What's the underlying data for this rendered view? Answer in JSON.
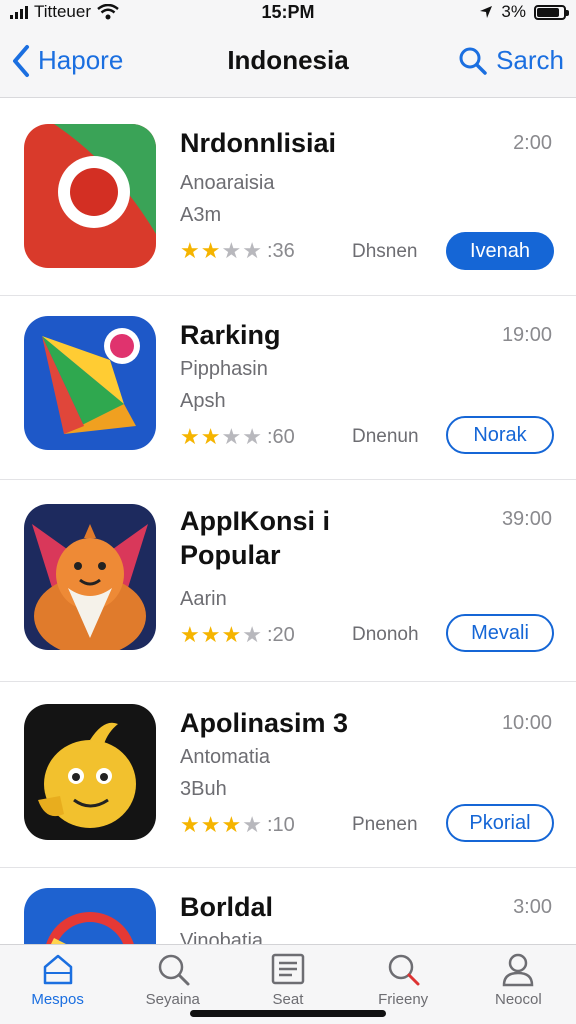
{
  "status": {
    "carrier": "Titteuer",
    "time": "15:PM",
    "battery": "3%"
  },
  "nav": {
    "back_label": "Hapore",
    "title": "Indonesia",
    "search_label": "Sarch"
  },
  "apps": [
    {
      "name": "Nrdonnlisiai",
      "time": "2:00",
      "subtitle": "Anoaraisia",
      "size": "A3m",
      "rating_count": ":36",
      "category": "Dhsnen",
      "button": "Ivenah",
      "button_style": "filled",
      "stars": 2.5
    },
    {
      "name": "Rarking",
      "time": "19:00",
      "subtitle": "Pipphasin",
      "size": "Apsh",
      "rating_count": ":60",
      "category": "Dnenun",
      "button": "Norak",
      "button_style": "outline",
      "stars": 2.5
    },
    {
      "name": "AppIKonsi i",
      "name_line2": "Popular",
      "time": "39:00",
      "subtitle": "Aarin",
      "rating_count": ":20",
      "category": "Dnonoh",
      "button": "Mevali",
      "button_style": "outline",
      "stars": 2.5
    },
    {
      "name": "Apolinasim 3",
      "time": "10:00",
      "subtitle": "Antomatia",
      "size": "3Buh",
      "rating_count": ":10",
      "category": "Pnenen",
      "button": "Pkorial",
      "button_style": "outline",
      "stars": 2.5
    },
    {
      "name": "Borldal",
      "time": "3:00",
      "subtitle": "Vinobatia"
    }
  ],
  "tabs": [
    {
      "label": "Mespos",
      "icon": "home-icon",
      "active": true
    },
    {
      "label": "Seyaina",
      "icon": "search-icon",
      "active": false
    },
    {
      "label": "Seat",
      "icon": "list-icon",
      "active": false
    },
    {
      "label": "Frieeny",
      "icon": "magnifier-icon",
      "active": false
    },
    {
      "label": "Neocol",
      "icon": "person-icon",
      "active": false
    }
  ],
  "colors": {
    "accent": "#1566d6",
    "star": "#f5b400",
    "bar_bg": "#f6f6f7"
  }
}
